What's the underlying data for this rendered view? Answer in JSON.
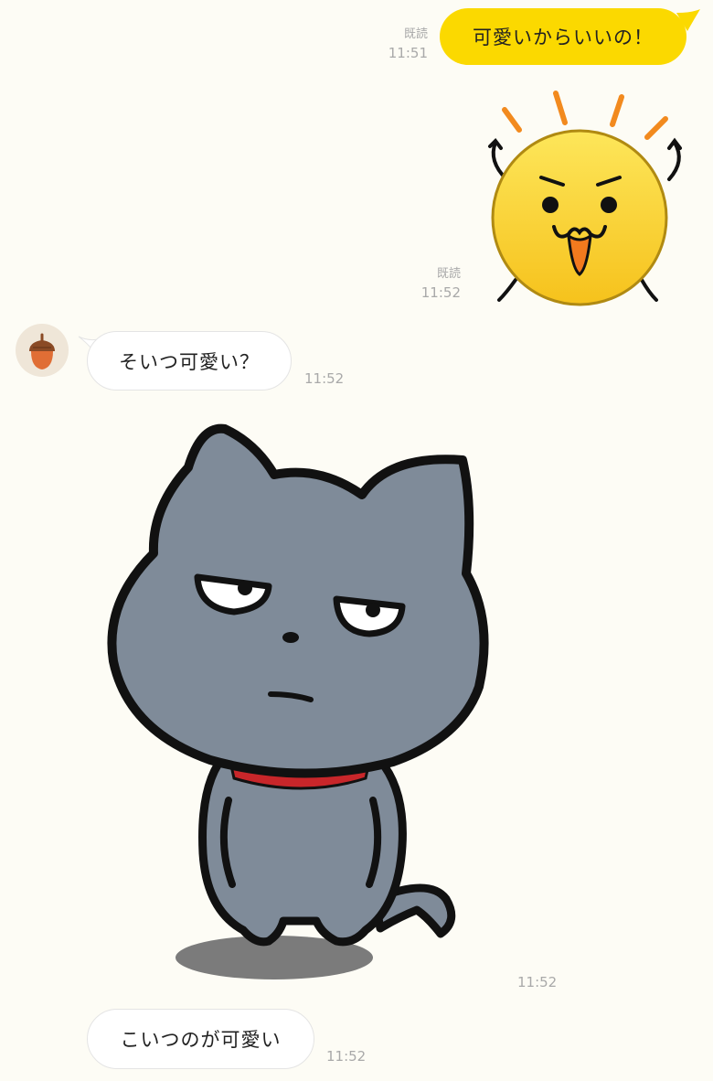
{
  "messages": [
    {
      "sender": "me",
      "text": "可愛いからいいの！",
      "read": "既読",
      "time": "11:51"
    },
    {
      "sender": "me",
      "sticker": "excited-yellow-face-sticker",
      "read": "既読",
      "time": "11:52"
    },
    {
      "sender": "other",
      "text": "そいつ可愛い？",
      "time": "11:52"
    },
    {
      "sender": "other",
      "sticker": "grumpy-gray-cat-sticker",
      "time": "11:52"
    },
    {
      "sender": "other",
      "text": "こいつのが可愛い",
      "time": "11:52"
    }
  ],
  "contact": {
    "avatar_icon": "acorn-icon"
  },
  "colors": {
    "background": "#fdfcf5",
    "my_bubble": "#fbd900",
    "their_bubble": "#ffffff",
    "meta_text": "#a9a9a9"
  }
}
